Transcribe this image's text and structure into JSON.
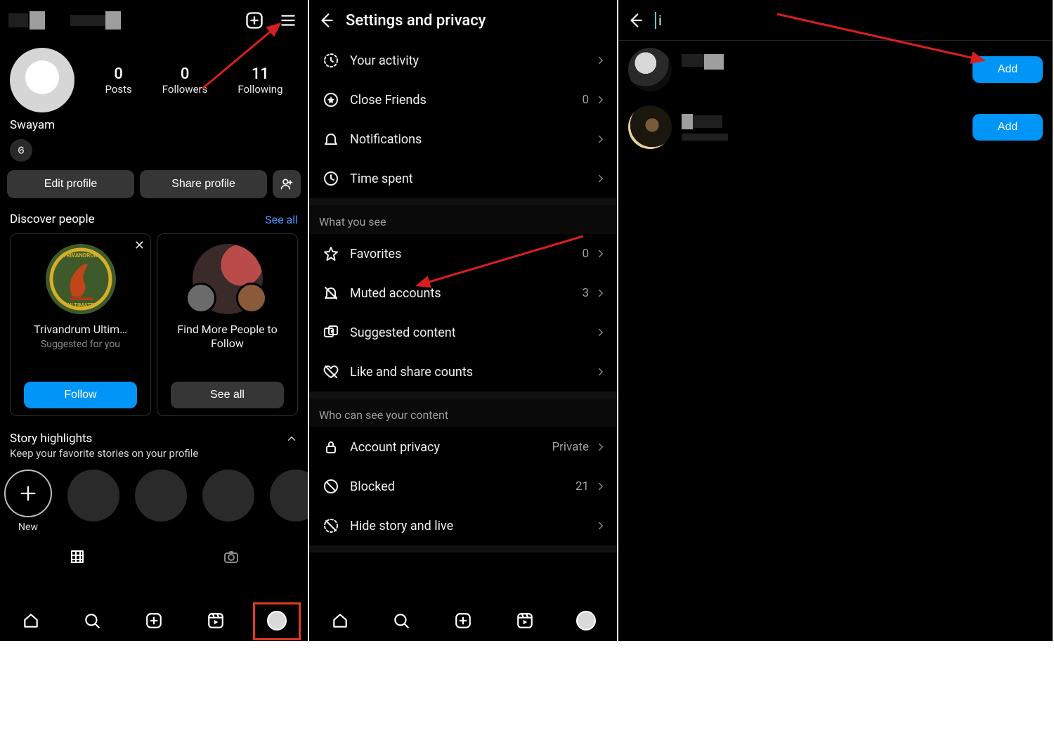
{
  "annotation": {
    "arrow1_from": "stats.following",
    "arrow1_to": "menu icon",
    "arrow2_to": "Favorites row",
    "arrow3_to": "Add button (first)"
  },
  "screen1": {
    "top_actions": {
      "create": "create-icon",
      "menu": "menu-icon"
    },
    "stats": {
      "posts": {
        "value": "0",
        "label": "Posts"
      },
      "followers": {
        "value": "0",
        "label": "Followers"
      },
      "following": {
        "value": "11",
        "label": "Following"
      }
    },
    "display_name": "Swayam",
    "buttons": {
      "edit": "Edit profile",
      "share": "Share profile"
    },
    "discover": {
      "title": "Discover people",
      "see_all": "See all",
      "cards": [
        {
          "name": "Trivandrum Ultim…",
          "sub": "Suggested for you",
          "cta": "Follow",
          "avatar": "trivandrum-ultimate-logo"
        },
        {
          "name": "Find More People to Follow",
          "sub": "",
          "cta": "See all",
          "avatar": "multi-avatar"
        }
      ]
    },
    "story_highlights": {
      "title": "Story highlights",
      "sub": "Keep your favorite stories on your profile",
      "new_label": "New"
    },
    "nav": [
      "home",
      "search",
      "create",
      "reels",
      "profile"
    ]
  },
  "screen2": {
    "title": "Settings and privacy",
    "section1": [
      {
        "icon": "activity",
        "label": "Your activity",
        "value": ""
      },
      {
        "icon": "closefriends",
        "label": "Close Friends",
        "value": "0"
      },
      {
        "icon": "notifications",
        "label": "Notifications",
        "value": ""
      },
      {
        "icon": "timespent",
        "label": "Time spent",
        "value": ""
      }
    ],
    "section2_header": "What you see",
    "section2": [
      {
        "icon": "favorites",
        "label": "Favorites",
        "value": "0"
      },
      {
        "icon": "muted",
        "label": "Muted accounts",
        "value": "3"
      },
      {
        "icon": "suggested",
        "label": "Suggested content",
        "value": ""
      },
      {
        "icon": "likes",
        "label": "Like and share counts",
        "value": ""
      }
    ],
    "section3_header": "Who can see your content",
    "section3": [
      {
        "icon": "lock",
        "label": "Account privacy",
        "value": "Private"
      },
      {
        "icon": "blocked",
        "label": "Blocked",
        "value": "21"
      },
      {
        "icon": "hidestory",
        "label": "Hide story and live",
        "value": ""
      }
    ]
  },
  "screen3": {
    "search": "i",
    "results": [
      {
        "add": "Add"
      },
      {
        "add": "Add"
      }
    ]
  }
}
